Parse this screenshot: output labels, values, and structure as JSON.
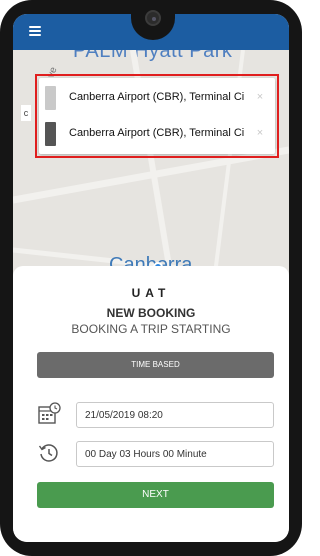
{
  "map": {
    "title": "PALM Hyatt Park",
    "road_label": "Ave",
    "side_tag": "c",
    "city_label": "Canberra"
  },
  "locations": [
    {
      "text": "Canberra Airport (CBR), Terminal Circ",
      "swatch_color": "#c9c9c9",
      "clear": "×"
    },
    {
      "text": "Canberra Airport (CBR), Terminal Circ",
      "swatch_color": "#555555",
      "clear": "×"
    }
  ],
  "sheet": {
    "brand": "UAT",
    "title": "NEW BOOKING",
    "subtitle": "BOOKING A TRIP STARTING",
    "mode_button": "TIME BASED",
    "date_field": {
      "value": "21/05/2019 08:20",
      "icon": "calendar-clock-icon"
    },
    "duration_field": {
      "value": "00 Day 03 Hours 00 Minute",
      "icon": "history-icon"
    },
    "next_button": "NEXT"
  },
  "colors": {
    "appbar": "#1c5da2",
    "highlight": "#e01e1e",
    "mode_button": "#6b6b6b",
    "next_button": "#4a9b4f"
  },
  "icons": {
    "menu": "menu-icon",
    "clear": "close-icon"
  }
}
